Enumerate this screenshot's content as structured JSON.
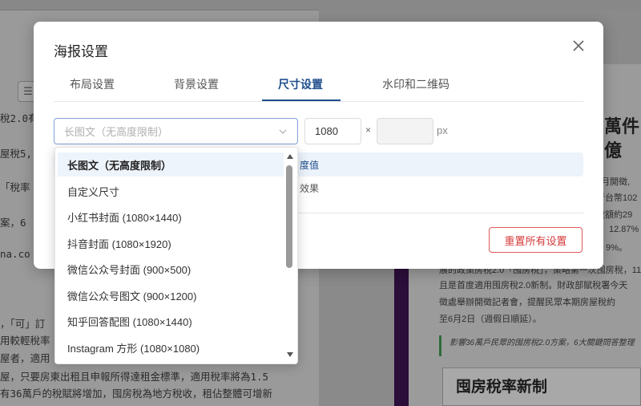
{
  "background": {
    "left_lines": [
      {
        "text": "稅2.0有"
      },
      {
        "text": "屋稅5,"
      },
      {
        "text": "「稅率"
      },
      {
        "text": "案，6"
      },
      {
        "text": "na.co"
      },
      {
        "text": "，「可」訂"
      },
      {
        "text": "用較輕稅率"
      },
      {
        "text": "屋者，適用"
      },
      {
        "text": "屋，只要房東出租且申報所得達租金標準，適用稅率將為1.5"
      },
      {
        "text": "有36萬戶的稅賦將增加，囤房稅為地方稅收，租佔整體可增新"
      }
    ],
    "headline": [
      "萬件",
      "億"
    ],
    "right_snippets": [
      "5月開徵,",
      "行台幣102",
      "稅額約29",
      "12.87%",
      "9%。",
      "展的政策房稅2.0「囤房稅」，策略第一次囤房稅，11",
      "且是首度適用囤房稅2.0新制。財政部賦稅署今天",
      "徵處舉辦開徵記者會，提醒民眾本期房屋稅約",
      "至6月2日（週假日順延）。"
    ],
    "quote": "影響36萬戶民眾的囤房稅2.0方案，6大關鍵問答整理",
    "banner": "囤房稅率新制"
  },
  "dialog": {
    "title": "海报设置",
    "tabs": [
      {
        "label": "布局设置"
      },
      {
        "label": "背景设置"
      },
      {
        "label": "尺寸设置"
      },
      {
        "label": "水印和二维码"
      }
    ],
    "active_tab": "尺寸设置",
    "size_select": {
      "placeholder": "长图文（无高度限制）"
    },
    "width_value": "1080",
    "times_sign": "×",
    "unit": "px",
    "info_text": "度值",
    "effect_text": "效果",
    "reset_button": "重置所有设置"
  },
  "dropdown": {
    "options": [
      {
        "label": "长图文（无高度限制）",
        "selected": true
      },
      {
        "label": "自定义尺寸"
      },
      {
        "label": "小红书封面 (1080×1440)"
      },
      {
        "label": "抖音封面 (1080×1920)"
      },
      {
        "label": "微信公众号封面 (900×500)"
      },
      {
        "label": "微信公众号图文 (900×1200)"
      },
      {
        "label": "知乎回答配图 (1080×1440)"
      },
      {
        "label": "Instagram 方形 (1080×1080)"
      }
    ]
  },
  "colors": {
    "accent": "#1e4e8c",
    "danger": "#d63a3a",
    "article_border": "#2b0e3a"
  }
}
